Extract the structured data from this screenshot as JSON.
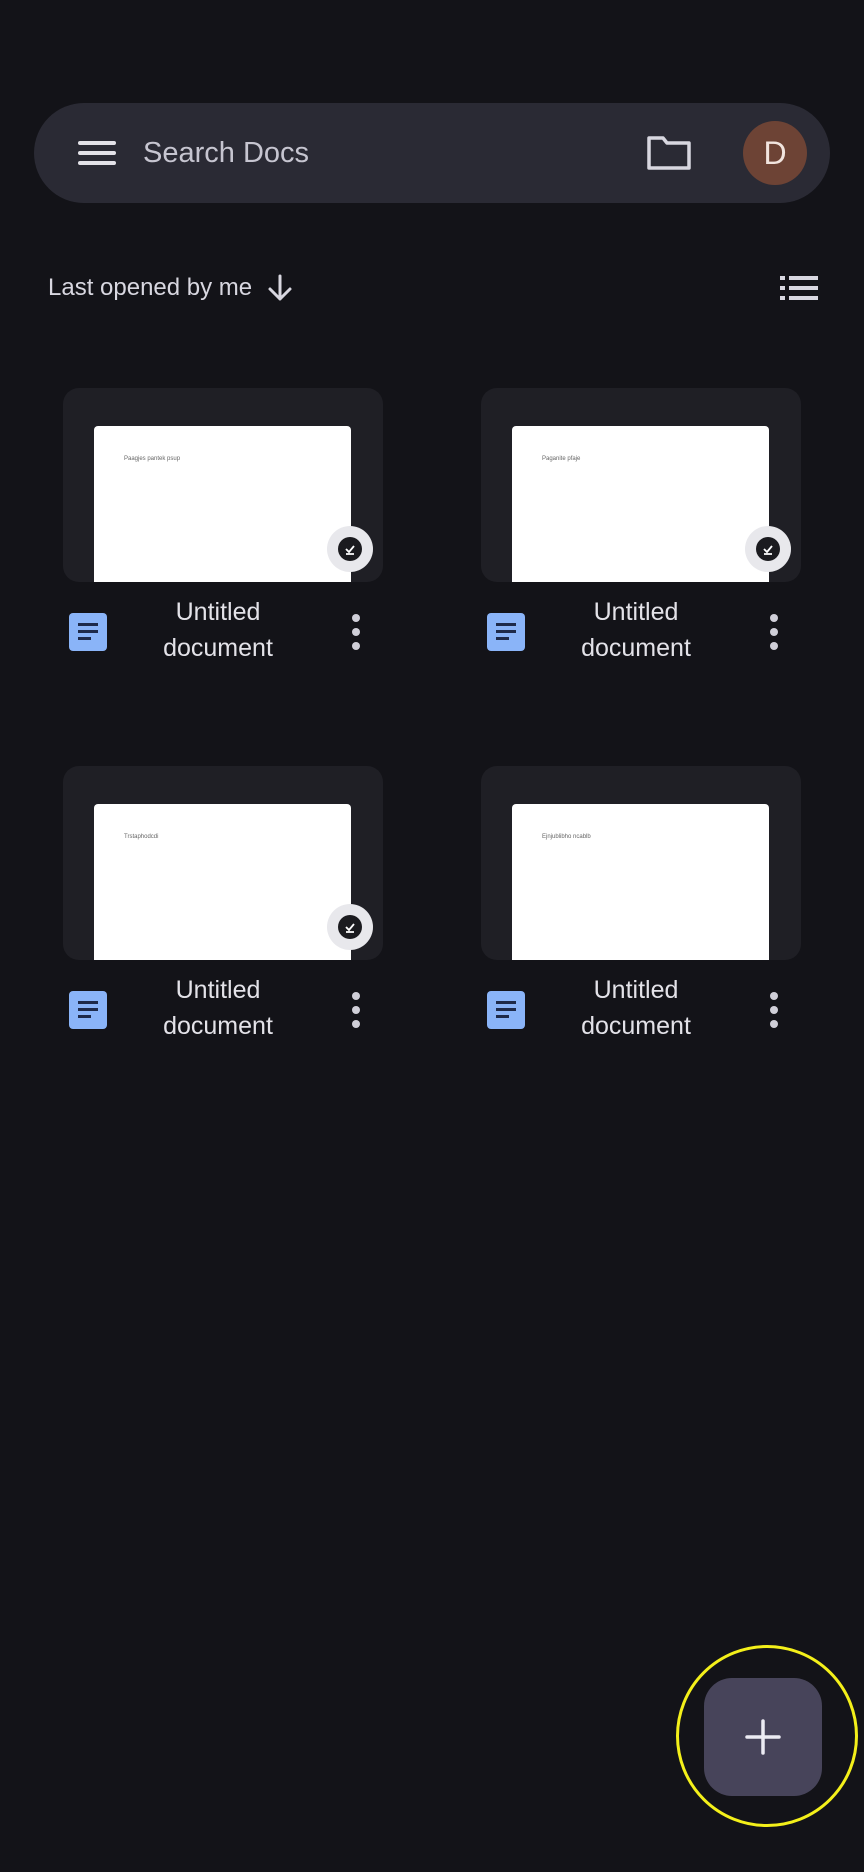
{
  "search": {
    "placeholder": "Search Docs"
  },
  "account": {
    "initial": "D",
    "color": "#6d4335"
  },
  "sort": {
    "label": "Last opened by me",
    "direction": "descending"
  },
  "icons": {
    "menu": "menu-icon",
    "folder": "folder-icon",
    "sort": "arrow-down-icon",
    "view": "list-view-icon",
    "doc": "docs-icon",
    "more": "more-vert-icon",
    "offline": "offline-available-icon",
    "fab": "plus-icon"
  },
  "documents": [
    {
      "title": "Untitled document",
      "preview_text": "Paagjes pantek psup",
      "offline": true
    },
    {
      "title": "Untitled document",
      "preview_text": "Paganite pfaje",
      "offline": true
    },
    {
      "title": "Untitled document",
      "preview_text": "Trstaphodcdi",
      "offline": true
    },
    {
      "title": "Untitled document",
      "preview_text": "Ejnjublibho ncablb",
      "offline": false
    }
  ],
  "colors": {
    "background": "#131318",
    "searchbar": "#2a2a34",
    "doc_icon": "#8ab4f8",
    "fab": "#47445a",
    "highlight": "#f4f01a"
  }
}
